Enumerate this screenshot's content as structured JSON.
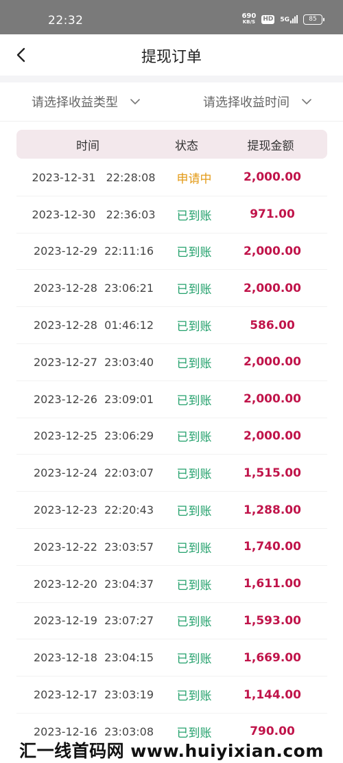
{
  "status_bar": {
    "time": "22:32",
    "speed_value": "690",
    "speed_unit": "KB/S",
    "hd_badge": "HD",
    "network": "5G",
    "battery": "85"
  },
  "nav": {
    "title": "提现订单",
    "back_icon": "chevron-left-icon"
  },
  "filters": [
    {
      "label": "请选择收益类型",
      "icon": "chevron-down-icon"
    },
    {
      "label": "请选择收益时间",
      "icon": "chevron-down-icon"
    }
  ],
  "table": {
    "headers": {
      "time": "时间",
      "status": "状态",
      "amount": "提现金额"
    },
    "rows": [
      {
        "time": "2023-12-31   22:28:08",
        "status": "申请中",
        "amount": "2,000.00"
      },
      {
        "time": "2023-12-30   22:36:03",
        "status": "已到账",
        "amount": "971.00"
      },
      {
        "time": "2023-12-29  22:11:16",
        "status": "已到账",
        "amount": "2,000.00"
      },
      {
        "time": "2023-12-28  23:06:21",
        "status": "已到账",
        "amount": "2,000.00"
      },
      {
        "time": "2023-12-28  01:46:12",
        "status": "已到账",
        "amount": "586.00"
      },
      {
        "time": "2023-12-27  23:03:40",
        "status": "已到账",
        "amount": "2,000.00"
      },
      {
        "time": "2023-12-26  23:09:01",
        "status": "已到账",
        "amount": "2,000.00"
      },
      {
        "time": "2023-12-25  23:06:29",
        "status": "已到账",
        "amount": "2,000.00"
      },
      {
        "time": "2023-12-24  22:03:07",
        "status": "已到账",
        "amount": "1,515.00"
      },
      {
        "time": "2023-12-23  22:20:43",
        "status": "已到账",
        "amount": "1,288.00"
      },
      {
        "time": "2023-12-22  23:03:57",
        "status": "已到账",
        "amount": "1,740.00"
      },
      {
        "time": "2023-12-20  23:04:37",
        "status": "已到账",
        "amount": "1,611.00"
      },
      {
        "time": "2023-12-19  23:07:27",
        "status": "已到账",
        "amount": "1,593.00"
      },
      {
        "time": "2023-12-18  23:04:15",
        "status": "已到账",
        "amount": "1,669.00"
      },
      {
        "time": "2023-12-17  23:03:19",
        "status": "已到账",
        "amount": "1,144.00"
      },
      {
        "time": "2023-12-16  23:03:08",
        "status": "已到账",
        "amount": "790.00"
      }
    ]
  },
  "colors": {
    "status_pending": "#e39a16",
    "status_done": "#22a06b",
    "amount": "#c0144a",
    "header_bg": "#f3e8ec"
  },
  "watermark": "汇一线首码网  www.huiyixian.com"
}
